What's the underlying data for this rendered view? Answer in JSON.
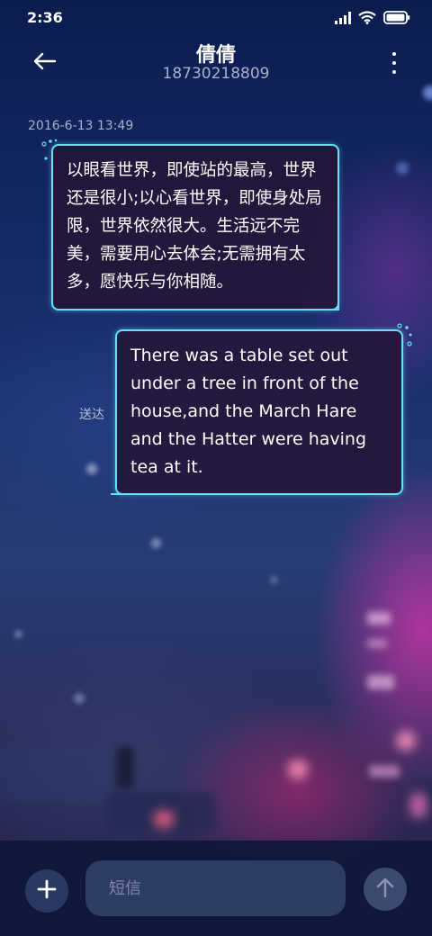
{
  "status_bar": {
    "time": "2:36",
    "icons": [
      "signal-icon",
      "wifi-icon",
      "battery-icon"
    ]
  },
  "header": {
    "contact_name": "倩倩",
    "contact_number": "18730218809",
    "back_icon": "back-arrow-icon",
    "menu_icon": "more-vertical-icon"
  },
  "conversation": {
    "timestamp": "2016-6-13 13:49",
    "messages": [
      {
        "direction": "incoming",
        "text": "以眼看世界，即使站的最高，世界还是很小;以心看世界，即使身处局限，世界依然很大。生活远不完美，需要用心去体会;无需拥有太多，愿快乐与你相随。"
      },
      {
        "direction": "outgoing",
        "text": "There was a table set out under a tree in front of the house,and the March Hare and the Hatter were having tea at it.",
        "status": "送达"
      }
    ]
  },
  "composer": {
    "placeholder": "短信",
    "value": "",
    "add_icon": "plus-icon",
    "send_icon": "send-arrow-icon"
  },
  "theme": {
    "bubble_border": "#62e2f4",
    "bubble_fill": "#251637",
    "composer_bg": "#0e183a"
  }
}
